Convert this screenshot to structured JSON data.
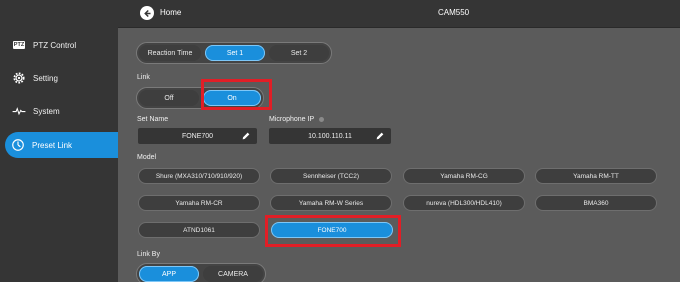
{
  "topbar": {
    "home_label": "Home",
    "camera_name": "CAM550"
  },
  "sidebar": {
    "items": [
      {
        "label": "PTZ Control",
        "icon": "ptz-icon",
        "badge": "PTZ"
      },
      {
        "label": "Setting",
        "icon": "gear-icon"
      },
      {
        "label": "System",
        "icon": "pulse-icon"
      },
      {
        "label": "Preset Link",
        "icon": "preset-link-icon",
        "active": true
      }
    ]
  },
  "tabs": {
    "items": [
      "Reaction Time",
      "Set 1",
      "Set 2"
    ],
    "selected": "Set 1"
  },
  "link": {
    "label": "Link",
    "options": [
      "Off",
      "On"
    ],
    "selected": "On"
  },
  "set_name": {
    "label": "Set Name",
    "value": "FONE700"
  },
  "microphone_ip": {
    "label": "Microphone IP",
    "value": "10.100.110.11"
  },
  "model": {
    "label": "Model",
    "options": [
      "Shure (MXA310/710/910/920)",
      "Sennheiser (TCC2)",
      "Yamaha RM-CG",
      "Yamaha RM-TT",
      "Yamaha RM-CR",
      "Yamaha RM-W Series",
      "nureva (HDL300/HDL410)",
      "BMA360",
      "ATND1061",
      "FONE700"
    ],
    "selected": "FONE700"
  },
  "link_by": {
    "label": "Link By",
    "options": [
      "APP",
      "CAMERA"
    ],
    "selected": "APP"
  },
  "colors": {
    "accent": "#1a8fdc",
    "highlight": "#e11e26",
    "sidebar_bg": "#353535",
    "content_bg": "#5b5b5b"
  }
}
